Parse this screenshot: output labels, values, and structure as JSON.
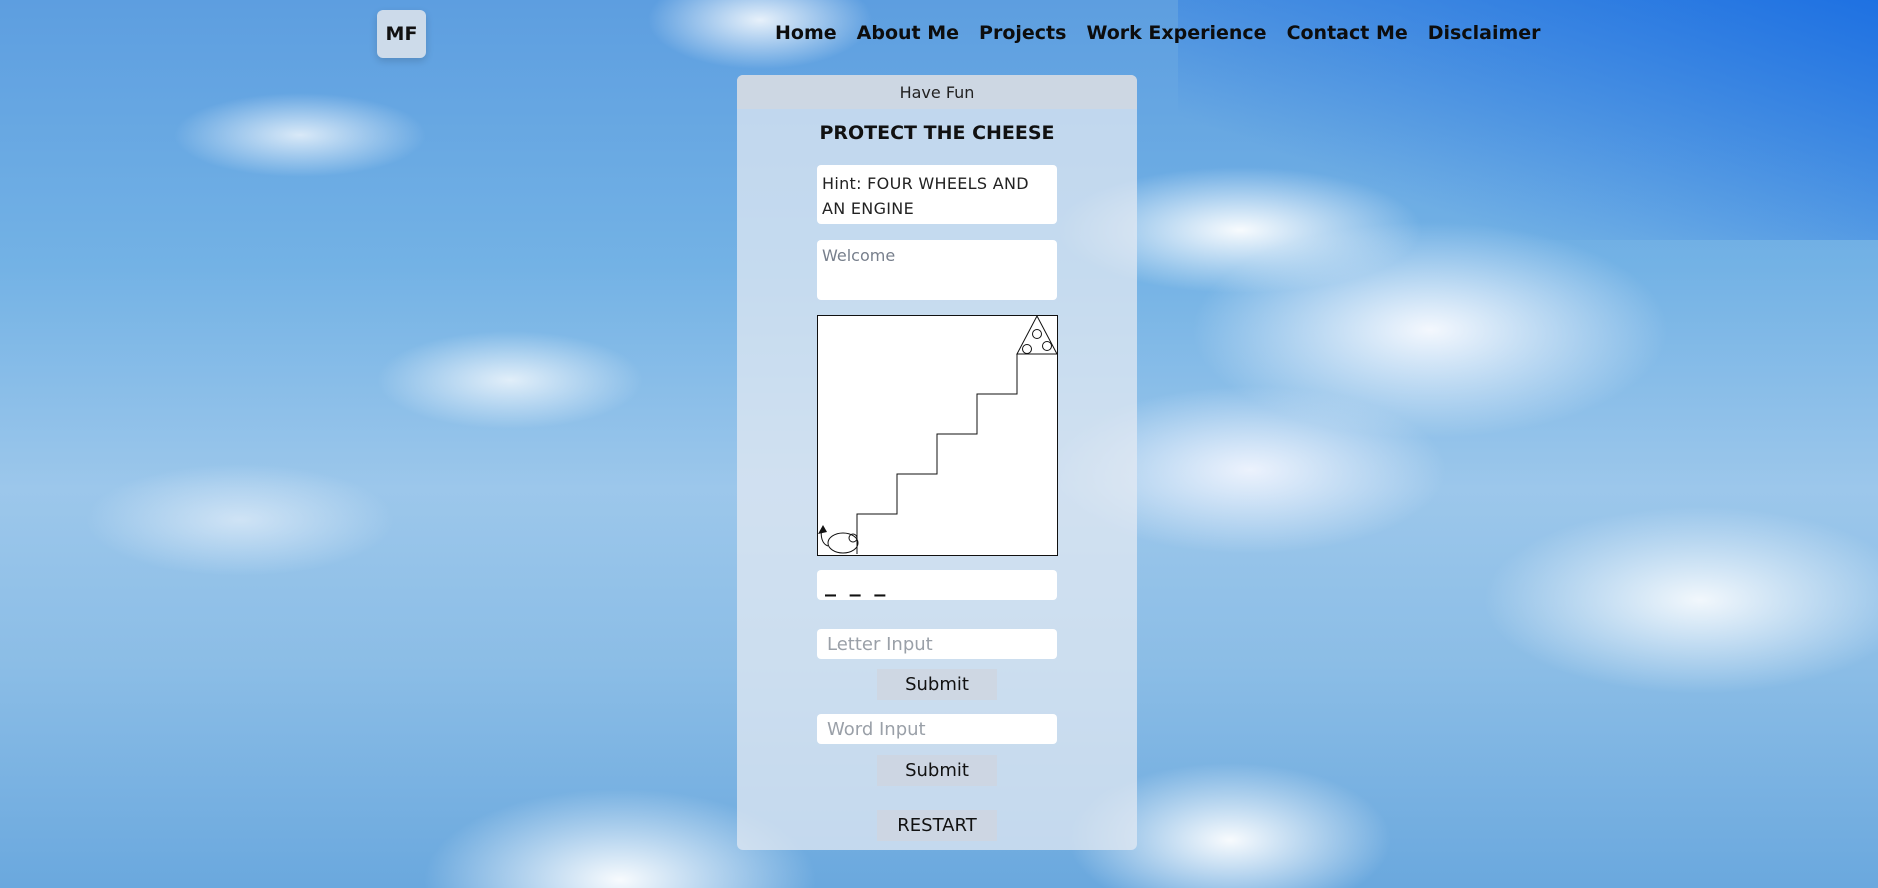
{
  "brand": {
    "logo": "MF"
  },
  "nav": {
    "items": [
      "Home",
      "About Me",
      "Projects",
      "Work Experience",
      "Contact Me",
      "Disclaimer"
    ]
  },
  "panel": {
    "header": "Have Fun",
    "title": "PROTECT THE CHEESE",
    "hint": "Hint: FOUR WHEELS AND AN ENGINE",
    "message": "Welcome",
    "word_blanks": "_ _ _",
    "letter_input": {
      "placeholder": "Letter Input",
      "value": ""
    },
    "letter_submit": "Submit",
    "word_input": {
      "placeholder": "Word Input",
      "value": ""
    },
    "word_submit": "Submit",
    "restart": "RESTART"
  },
  "game": {
    "icons": [
      "mouse-icon",
      "cheese-icon"
    ],
    "staircase_steps": 5
  },
  "colors": {
    "panel_bg": "#e4eaf2",
    "header_bg": "#ced7e2",
    "button_bg": "#cdd6e1",
    "sky_accent": "#176ce2"
  }
}
